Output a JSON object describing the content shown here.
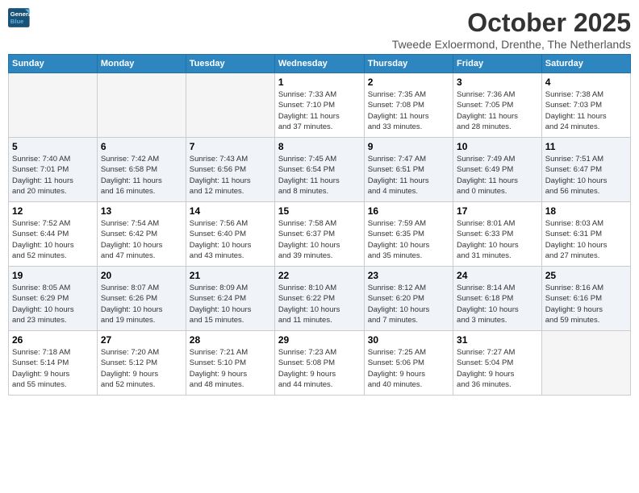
{
  "logo": {
    "line1": "General",
    "line2": "Blue"
  },
  "title": "October 2025",
  "subtitle": "Tweede Exloermond, Drenthe, The Netherlands",
  "weekdays": [
    "Sunday",
    "Monday",
    "Tuesday",
    "Wednesday",
    "Thursday",
    "Friday",
    "Saturday"
  ],
  "weeks": [
    [
      {
        "day": "",
        "info": ""
      },
      {
        "day": "",
        "info": ""
      },
      {
        "day": "",
        "info": ""
      },
      {
        "day": "1",
        "info": "Sunrise: 7:33 AM\nSunset: 7:10 PM\nDaylight: 11 hours\nand 37 minutes."
      },
      {
        "day": "2",
        "info": "Sunrise: 7:35 AM\nSunset: 7:08 PM\nDaylight: 11 hours\nand 33 minutes."
      },
      {
        "day": "3",
        "info": "Sunrise: 7:36 AM\nSunset: 7:05 PM\nDaylight: 11 hours\nand 28 minutes."
      },
      {
        "day": "4",
        "info": "Sunrise: 7:38 AM\nSunset: 7:03 PM\nDaylight: 11 hours\nand 24 minutes."
      }
    ],
    [
      {
        "day": "5",
        "info": "Sunrise: 7:40 AM\nSunset: 7:01 PM\nDaylight: 11 hours\nand 20 minutes."
      },
      {
        "day": "6",
        "info": "Sunrise: 7:42 AM\nSunset: 6:58 PM\nDaylight: 11 hours\nand 16 minutes."
      },
      {
        "day": "7",
        "info": "Sunrise: 7:43 AM\nSunset: 6:56 PM\nDaylight: 11 hours\nand 12 minutes."
      },
      {
        "day": "8",
        "info": "Sunrise: 7:45 AM\nSunset: 6:54 PM\nDaylight: 11 hours\nand 8 minutes."
      },
      {
        "day": "9",
        "info": "Sunrise: 7:47 AM\nSunset: 6:51 PM\nDaylight: 11 hours\nand 4 minutes."
      },
      {
        "day": "10",
        "info": "Sunrise: 7:49 AM\nSunset: 6:49 PM\nDaylight: 11 hours\nand 0 minutes."
      },
      {
        "day": "11",
        "info": "Sunrise: 7:51 AM\nSunset: 6:47 PM\nDaylight: 10 hours\nand 56 minutes."
      }
    ],
    [
      {
        "day": "12",
        "info": "Sunrise: 7:52 AM\nSunset: 6:44 PM\nDaylight: 10 hours\nand 52 minutes."
      },
      {
        "day": "13",
        "info": "Sunrise: 7:54 AM\nSunset: 6:42 PM\nDaylight: 10 hours\nand 47 minutes."
      },
      {
        "day": "14",
        "info": "Sunrise: 7:56 AM\nSunset: 6:40 PM\nDaylight: 10 hours\nand 43 minutes."
      },
      {
        "day": "15",
        "info": "Sunrise: 7:58 AM\nSunset: 6:37 PM\nDaylight: 10 hours\nand 39 minutes."
      },
      {
        "day": "16",
        "info": "Sunrise: 7:59 AM\nSunset: 6:35 PM\nDaylight: 10 hours\nand 35 minutes."
      },
      {
        "day": "17",
        "info": "Sunrise: 8:01 AM\nSunset: 6:33 PM\nDaylight: 10 hours\nand 31 minutes."
      },
      {
        "day": "18",
        "info": "Sunrise: 8:03 AM\nSunset: 6:31 PM\nDaylight: 10 hours\nand 27 minutes."
      }
    ],
    [
      {
        "day": "19",
        "info": "Sunrise: 8:05 AM\nSunset: 6:29 PM\nDaylight: 10 hours\nand 23 minutes."
      },
      {
        "day": "20",
        "info": "Sunrise: 8:07 AM\nSunset: 6:26 PM\nDaylight: 10 hours\nand 19 minutes."
      },
      {
        "day": "21",
        "info": "Sunrise: 8:09 AM\nSunset: 6:24 PM\nDaylight: 10 hours\nand 15 minutes."
      },
      {
        "day": "22",
        "info": "Sunrise: 8:10 AM\nSunset: 6:22 PM\nDaylight: 10 hours\nand 11 minutes."
      },
      {
        "day": "23",
        "info": "Sunrise: 8:12 AM\nSunset: 6:20 PM\nDaylight: 10 hours\nand 7 minutes."
      },
      {
        "day": "24",
        "info": "Sunrise: 8:14 AM\nSunset: 6:18 PM\nDaylight: 10 hours\nand 3 minutes."
      },
      {
        "day": "25",
        "info": "Sunrise: 8:16 AM\nSunset: 6:16 PM\nDaylight: 9 hours\nand 59 minutes."
      }
    ],
    [
      {
        "day": "26",
        "info": "Sunrise: 7:18 AM\nSunset: 5:14 PM\nDaylight: 9 hours\nand 55 minutes."
      },
      {
        "day": "27",
        "info": "Sunrise: 7:20 AM\nSunset: 5:12 PM\nDaylight: 9 hours\nand 52 minutes."
      },
      {
        "day": "28",
        "info": "Sunrise: 7:21 AM\nSunset: 5:10 PM\nDaylight: 9 hours\nand 48 minutes."
      },
      {
        "day": "29",
        "info": "Sunrise: 7:23 AM\nSunset: 5:08 PM\nDaylight: 9 hours\nand 44 minutes."
      },
      {
        "day": "30",
        "info": "Sunrise: 7:25 AM\nSunset: 5:06 PM\nDaylight: 9 hours\nand 40 minutes."
      },
      {
        "day": "31",
        "info": "Sunrise: 7:27 AM\nSunset: 5:04 PM\nDaylight: 9 hours\nand 36 minutes."
      },
      {
        "day": "",
        "info": ""
      }
    ]
  ]
}
